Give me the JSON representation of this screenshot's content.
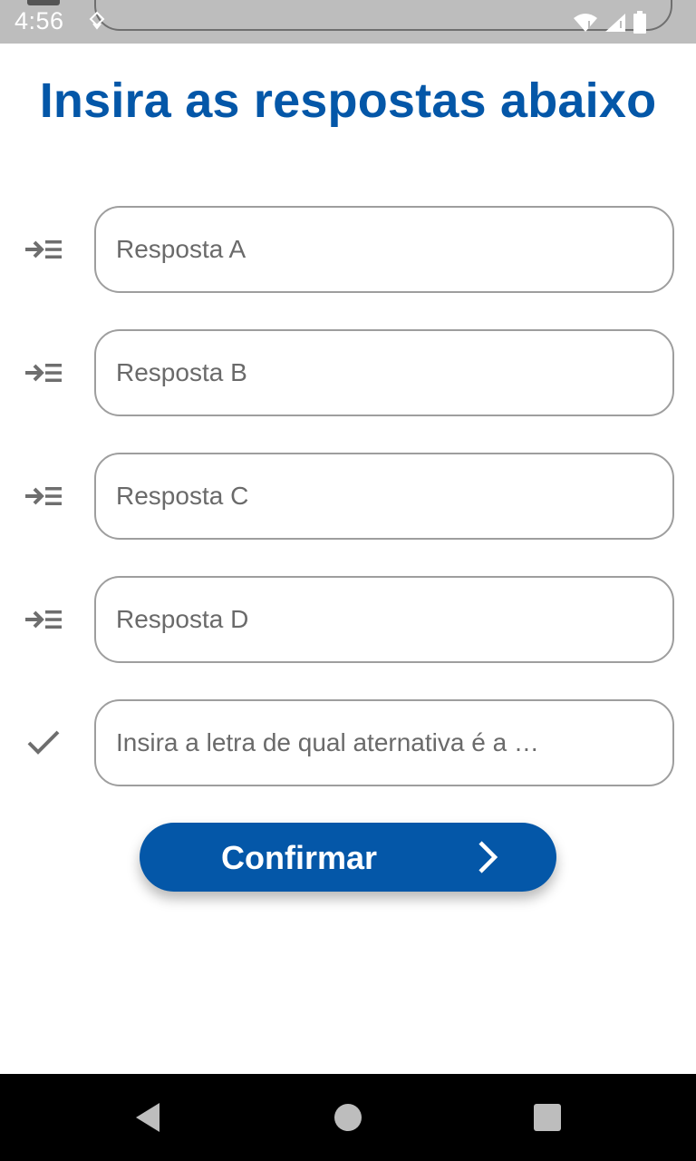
{
  "status_bar": {
    "time": "4:56",
    "icons": [
      "sync-icon",
      "wifi-icon",
      "signal-icon",
      "battery-icon"
    ]
  },
  "page": {
    "title": "Insira as respostas abaixo"
  },
  "form": {
    "fields": [
      {
        "icon": "indent-arrow-icon",
        "placeholder": "Resposta A",
        "value": ""
      },
      {
        "icon": "indent-arrow-icon",
        "placeholder": "Resposta B",
        "value": ""
      },
      {
        "icon": "indent-arrow-icon",
        "placeholder": "Resposta C",
        "value": ""
      },
      {
        "icon": "indent-arrow-icon",
        "placeholder": "Resposta D",
        "value": ""
      },
      {
        "icon": "check-icon",
        "placeholder": "Insira a letra de qual aternativa é a …",
        "value": ""
      }
    ],
    "confirm_label": "Confirmar"
  },
  "navigation": {
    "buttons": [
      "back-icon",
      "home-icon",
      "recents-icon"
    ]
  },
  "colors": {
    "accent": "#0457a8",
    "status_bar_bg": "#bdbdbd",
    "field_border": "#9e9e9e",
    "nav_bar_bg": "#000000"
  }
}
